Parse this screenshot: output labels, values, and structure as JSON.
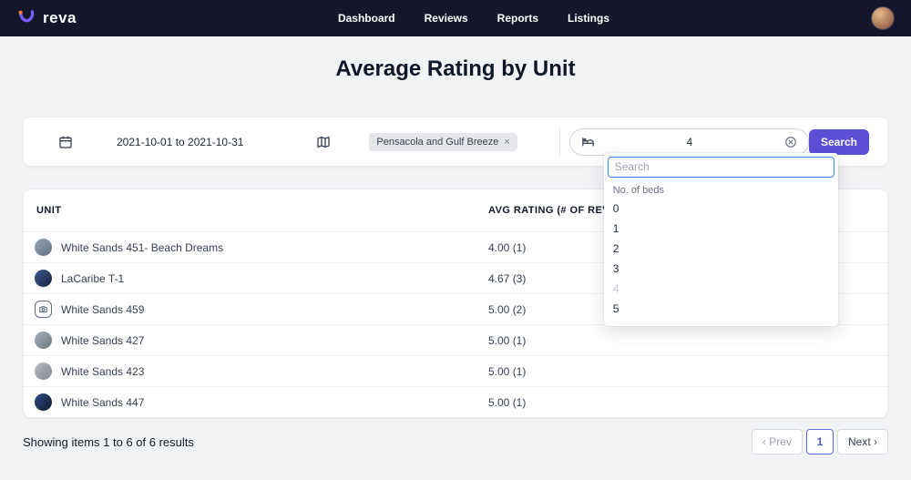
{
  "navbar": {
    "brand": "reva",
    "items": [
      {
        "label": "Dashboard"
      },
      {
        "label": "Reviews"
      },
      {
        "label": "Reports"
      },
      {
        "label": "Listings"
      }
    ]
  },
  "page": {
    "title": "Average Rating by Unit"
  },
  "filters": {
    "date_range": "2021-10-01 to 2021-10-31",
    "location_tag": "Pensacola and Gulf Breeze",
    "location_tag_remove": "×",
    "beds_value": "4",
    "search_button": "Search"
  },
  "beds_dropdown": {
    "search_placeholder": "Search",
    "group_label": "No. of beds",
    "options": [
      "0",
      "1",
      "2",
      "3",
      "4",
      "5"
    ],
    "selected": "4"
  },
  "table": {
    "headers": [
      "UNIT",
      "AVG RATING (# OF REVIEWS)"
    ],
    "rows": [
      {
        "unit": "White Sands 451- Beach Dreams",
        "rating": "4.00 (1)"
      },
      {
        "unit": "LaCaribe T-1",
        "rating": "4.67 (3)"
      },
      {
        "unit": "White Sands 459",
        "rating": "5.00 (2)"
      },
      {
        "unit": "White Sands 427",
        "rating": "5.00 (1)"
      },
      {
        "unit": "White Sands 423",
        "rating": "5.00 (1)"
      },
      {
        "unit": "White Sands 447",
        "rating": "5.00 (1)"
      }
    ]
  },
  "footer": {
    "summary": "Showing items 1 to 6 of 6 results",
    "prev": "‹ Prev",
    "page": "1",
    "next": "Next ›"
  },
  "icons": {
    "logo": "reva-swoosh",
    "calendar": "calendar-icon",
    "map": "map-icon",
    "bed": "bed-icon",
    "clear": "clear-circle-icon",
    "camera": "camera-icon"
  },
  "colors": {
    "navbar_bg": "#14172b",
    "accent": "#5b4fd6",
    "active_page_border": "#5b6ee0",
    "dropdown_focus_border": "#3b82f6"
  }
}
